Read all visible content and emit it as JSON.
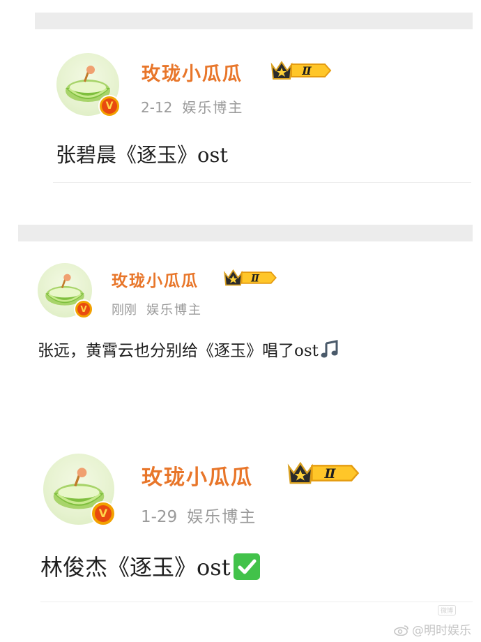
{
  "posts": [
    {
      "author": "玫珑小瓜瓜",
      "level_badge": "Ⅱ",
      "verified_mark": "V",
      "date": "2-12",
      "category": "娱乐博主",
      "text": "张碧晨《逐玉》ost",
      "emoji": ""
    },
    {
      "author": "玫珑小瓜瓜",
      "level_badge": "Ⅱ",
      "verified_mark": "V",
      "date": "刚刚",
      "category": "娱乐博主",
      "text": "张远，黄霄云也分别给《逐玉》唱了ost",
      "emoji": "music-note-emoji"
    },
    {
      "author": "玫珑小瓜瓜",
      "level_badge": "Ⅱ",
      "verified_mark": "V",
      "date": "1-29",
      "category": "娱乐博主",
      "text": "林俊杰《逐玉》ost",
      "emoji": "check-mark-emoji"
    }
  ],
  "watermark": {
    "text": "@明时娱乐",
    "small_mark": "微博"
  },
  "colors": {
    "name": "#e8762a",
    "meta": "#9a9a9a",
    "badge_gold": "#f2a100",
    "badge_red": "#e84a10",
    "separator": "#ececec"
  }
}
